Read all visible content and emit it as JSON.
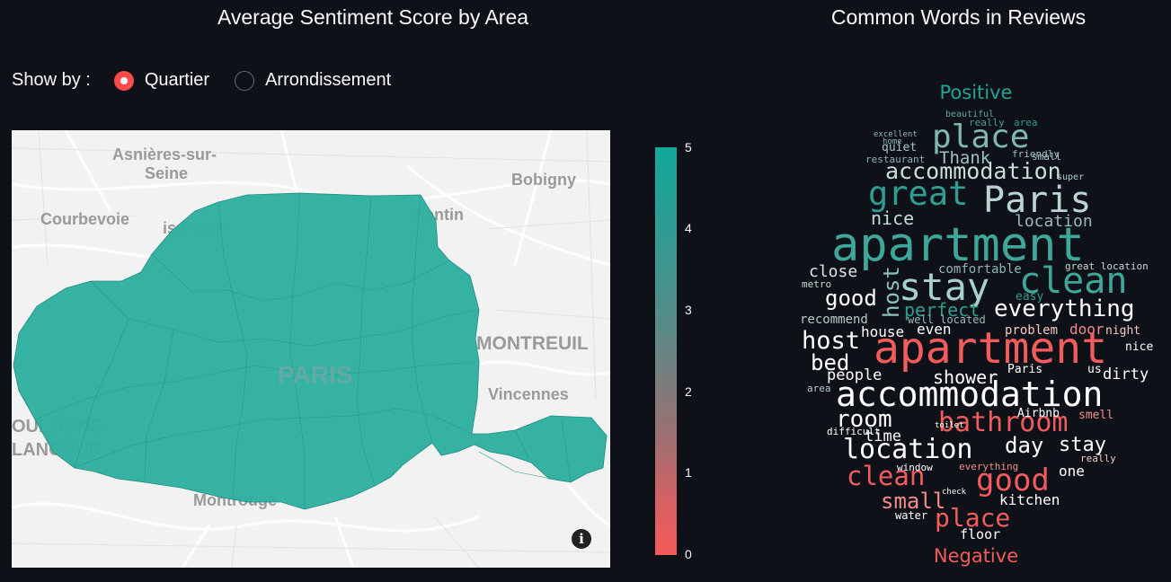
{
  "titles": {
    "map": "Average Sentiment Score by Area",
    "wordcloud": "Common Words in Reviews"
  },
  "show_by": {
    "label": "Show by :",
    "options": [
      "Quartier",
      "Arrondissement"
    ],
    "selected": "Quartier"
  },
  "map": {
    "place_labels": {
      "asnieres_1": "Asnières-sur-",
      "asnieres_2": "Seine",
      "bobigny": "Bobigny",
      "courbevoie": "Courbevoie",
      "levallois": "is-Perret",
      "pantin": "Pantin",
      "paris": "PARIS",
      "montreuil": "MONTREUIL",
      "vincennes": "Vincennes",
      "boulogne_1": "OULOGNE-",
      "boulogne_2": "LANCOUR",
      "montrouge": "Montrouge"
    },
    "fill_color": "#2fb0a0",
    "info_icon": "info-icon"
  },
  "colorbar": {
    "ticks": [
      "5",
      "4",
      "3",
      "2",
      "1",
      "0"
    ],
    "top_color": "#12a89a",
    "bottom_color": "#f45b5b"
  },
  "wordcloud": {
    "positive_label": "Positive",
    "negative_label": "Negative",
    "positive_color": "#1fa594",
    "negative_color": "#f25c5c",
    "positive_words": [
      "beautiful",
      "really",
      "area",
      "excellent",
      "home",
      "quiet",
      "friendly",
      "restaurant",
      "super",
      "small",
      "Thank",
      "place",
      "accommodation",
      "great",
      "Paris",
      "nice",
      "location",
      "apartment",
      "close",
      "comfortable",
      "great location",
      "metro",
      "stay",
      "clean",
      "good",
      "host",
      "perfect",
      "everything",
      "recommend",
      "easy",
      "well located"
    ],
    "negative_words": [
      "house",
      "even",
      "problem",
      "door",
      "night",
      "host",
      "apartment",
      "bed",
      "nice",
      "people",
      "shower",
      "Paris",
      "us",
      "dirty",
      "area",
      "accommodation",
      "room",
      "bathroom",
      "smell",
      "time",
      "Airbnb",
      "difficult",
      "location",
      "day",
      "stay",
      "really",
      "clean",
      "good",
      "one",
      "window",
      "everything",
      "small",
      "kitchen",
      "water",
      "place",
      "floor",
      "toilet",
      "check"
    ]
  }
}
